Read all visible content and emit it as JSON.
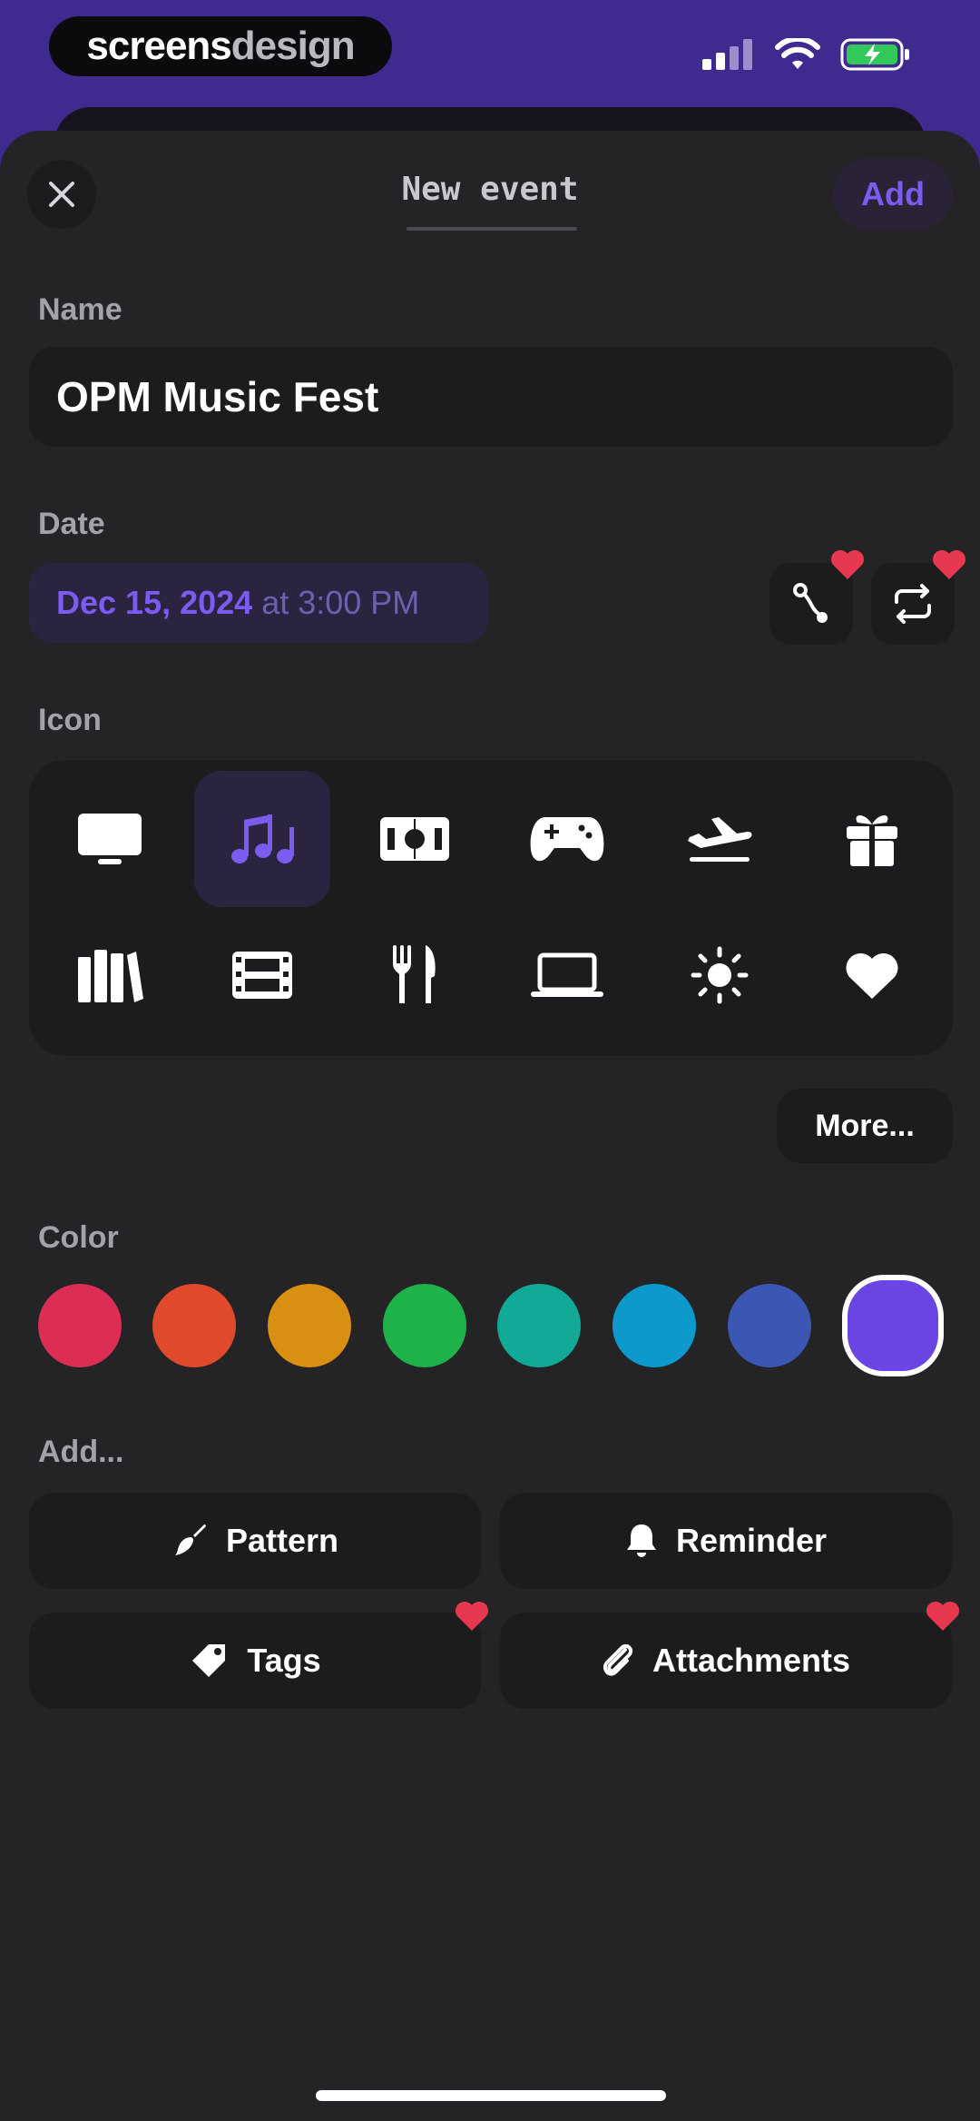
{
  "status_bar": {
    "brand_part1": "screens",
    "brand_part2": "design"
  },
  "header": {
    "title": "New event",
    "add_label": "Add"
  },
  "name": {
    "label": "Name",
    "value": "OPM Music Fest"
  },
  "date": {
    "label": "Date",
    "date": "Dec 15, 2024",
    "connector": "at",
    "time": "3:00 PM"
  },
  "icon_section": {
    "label": "Icon",
    "icons": [
      "tv-icon",
      "music-notes-icon",
      "stadium-icon",
      "gamepad-icon",
      "airplane-icon",
      "gift-icon",
      "books-icon",
      "film-icon",
      "fork-knife-icon",
      "laptop-icon",
      "sun-icon",
      "heart-icon"
    ],
    "selected": "music-notes-icon",
    "more_label": "More..."
  },
  "color_section": {
    "label": "Color",
    "swatches": [
      "#dc2e55",
      "#df4a2a",
      "#d88f12",
      "#1fb24a",
      "#12a996",
      "#0d99cc",
      "#3c57b3",
      "#6a45e3"
    ],
    "selected_index": 7
  },
  "add_section": {
    "label": "Add...",
    "pattern_label": "Pattern",
    "reminder_label": "Reminder",
    "tags_label": "Tags",
    "attachments_label": "Attachments"
  },
  "colors": {
    "accent": "#7c5cf0",
    "heart": "#e8384f",
    "sheet": "#242326",
    "field": "#1c1b1e"
  }
}
